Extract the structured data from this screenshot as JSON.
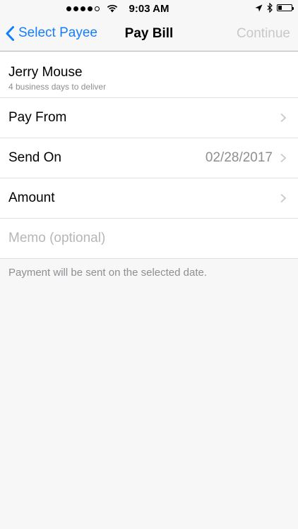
{
  "status_bar": {
    "time": "9:03 AM",
    "signal_icon": "signal-dots-icon",
    "wifi_icon": "wifi-icon",
    "location_icon": "location-arrow-icon",
    "bluetooth_icon": "bluetooth-icon",
    "battery_icon": "battery-icon",
    "battery_level": 0.25
  },
  "nav": {
    "back_label": "Select Payee",
    "title": "Pay Bill",
    "action_label": "Continue",
    "accent_color": "#157efb",
    "disabled_color": "#c8c8cc"
  },
  "payee": {
    "name": "Jerry Mouse",
    "delivery_note": "4 business days to deliver"
  },
  "rows": {
    "pay_from": {
      "label": "Pay From",
      "value": ""
    },
    "send_on": {
      "label": "Send On",
      "value": "02/28/2017"
    },
    "amount": {
      "label": "Amount",
      "value": ""
    }
  },
  "memo": {
    "placeholder": "Memo (optional)"
  },
  "footer": {
    "note": "Payment will be sent on the selected date."
  }
}
